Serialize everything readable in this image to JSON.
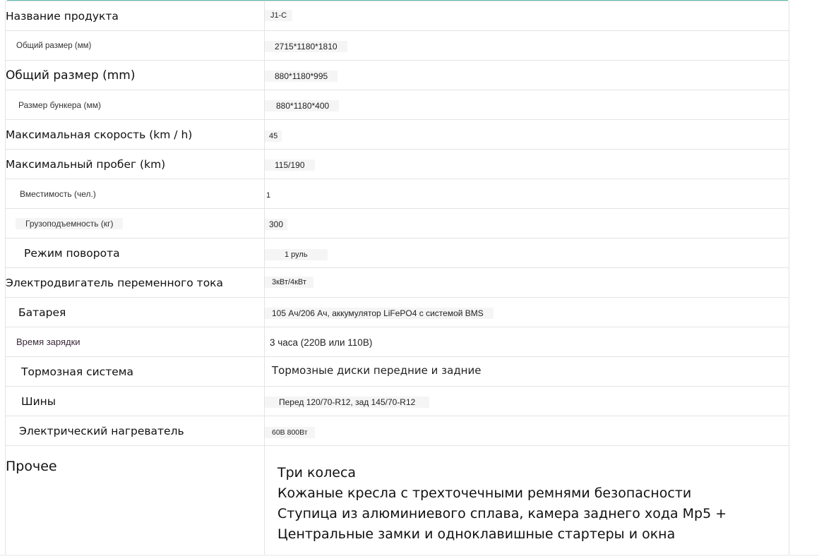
{
  "spec_table": {
    "rows": [
      {
        "label": "Название продукта",
        "value": "J1-C"
      },
      {
        "label": "Общий размер (мм)",
        "value": "2715*1180*1810"
      },
      {
        "label": "Общий размер (mm)",
        "value": "880*1180*995"
      },
      {
        "label": "Размер бункера (мм)",
        "value": "880*1180*400"
      },
      {
        "label": "Максимальная скорость (km / h)",
        "value": "45"
      },
      {
        "label": "Максимальный пробег (km)",
        "value": "115/190"
      },
      {
        "label": "Вместимость (чел.)",
        "value": "1"
      },
      {
        "label": "Грузоподъемность (кг)",
        "value": "300"
      },
      {
        "label": "Режим поворота",
        "value": "1 руль"
      },
      {
        "label": "Электродвигатель переменного тока",
        "value": "3кВт/4кВт"
      },
      {
        "label": "Батарея",
        "value": "105 Ач/206 Ач, аккумулятор LiFePO4 с системой BMS"
      },
      {
        "label": "Время зарядки",
        "value": "3 часа (220В или 110В)"
      },
      {
        "label": "Тормозная система",
        "value": "Тормозные диски передние и задние"
      },
      {
        "label": "Шины",
        "value": "Перед 120/70-R12, зад 145/70-R12"
      },
      {
        "label": "Электрический нагреватель",
        "value": "60В 800Вт"
      }
    ],
    "other": {
      "label": "Прочее",
      "lines": [
        "Три колеса",
        "Кожаные кресла с трехточечными ремнями безопасности",
        "Ступица из алюминиевого сплава, камера заднего хода Mp5 +",
        "Центральные замки и одноклавишные стартеры и окна"
      ]
    }
  },
  "colors": {
    "top_rule": "#5bbfb0",
    "grid": "#e3e3e3",
    "value_chip_bg": "#f5f5f5"
  }
}
